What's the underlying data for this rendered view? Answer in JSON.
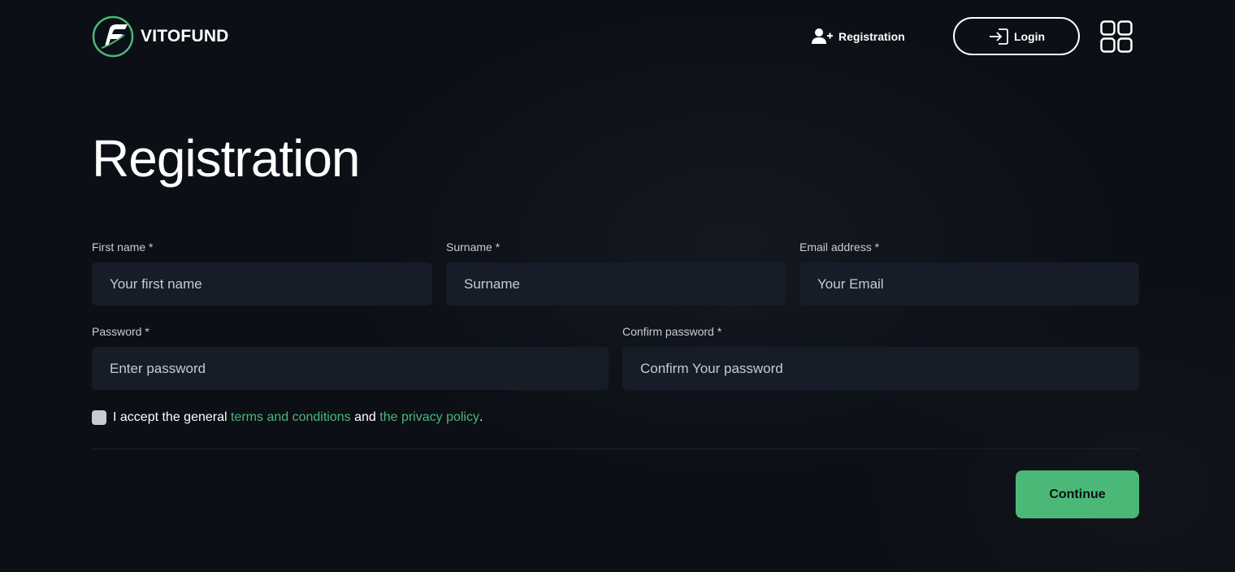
{
  "brand": {
    "name": "VITOFUND",
    "accent": "#4bb878"
  },
  "header": {
    "register_label": "Registration",
    "login_label": "Login"
  },
  "page": {
    "title": "Registration"
  },
  "form": {
    "first_name": {
      "label": "First name *",
      "placeholder": "Your first name",
      "value": ""
    },
    "surname": {
      "label": "Surname *",
      "placeholder": "Surname",
      "value": ""
    },
    "email": {
      "label": "Email address *",
      "placeholder": "Your Email",
      "value": ""
    },
    "password": {
      "label": "Password *",
      "placeholder": "Enter password",
      "value": ""
    },
    "confirm_password": {
      "label": "Confirm password *",
      "placeholder": "Confirm Your password",
      "value": ""
    },
    "terms": {
      "checked": false,
      "prefix": "I accept the general",
      "terms_link": "terms and conditions",
      "conjunction": "and",
      "privacy_link": "the privacy policy",
      "suffix": "."
    },
    "continue_label": "Continue"
  },
  "icons": {
    "logo": "vitofund-logo-icon",
    "register": "user-plus-icon",
    "login": "sign-in-icon",
    "menu": "apps-grid-icon"
  }
}
